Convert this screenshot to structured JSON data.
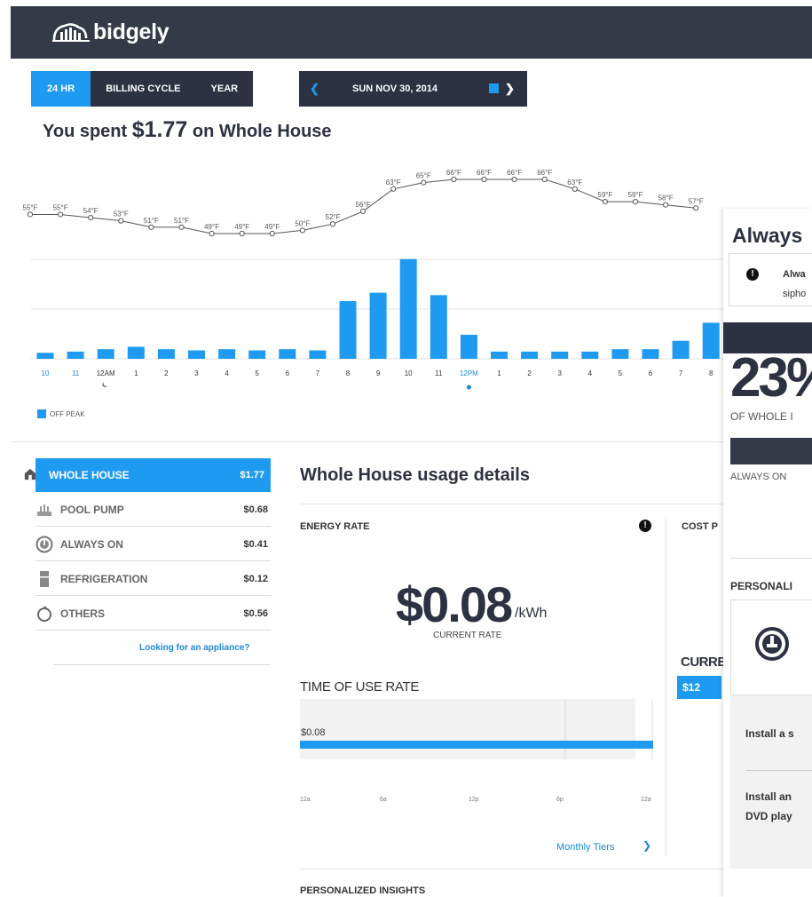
{
  "brand": {
    "name": "bidgely"
  },
  "range_buttons": [
    "24 HR",
    "BILLING CYCLE",
    "YEAR"
  ],
  "active_range": "24 HR",
  "date_nav": {
    "date": "SUN NOV 30, 2014",
    "prev_icon": "chevron-left-icon",
    "next_icon": "chevron-right-icon",
    "calendar_icon": "calendar-icon"
  },
  "headline": {
    "prefix": "You spent ",
    "amount": "$1.77",
    "suffix": " on Whole House"
  },
  "chart_data": {
    "type": "bar",
    "categories": [
      "10",
      "11",
      "12AM",
      "1",
      "2",
      "3",
      "4",
      "5",
      "6",
      "7",
      "8",
      "9",
      "10",
      "11",
      "12PM",
      "1",
      "2",
      "3",
      "4",
      "5",
      "6",
      "7",
      "8"
    ],
    "values": [
      0.5,
      0.6,
      0.8,
      1.0,
      0.8,
      0.7,
      0.8,
      0.7,
      0.8,
      0.7,
      4.8,
      5.5,
      8.3,
      5.3,
      2.0,
      0.6,
      0.6,
      0.6,
      0.6,
      0.8,
      0.8,
      1.5,
      3.0
    ],
    "temperatures": [
      "55°F",
      "55°F",
      "54°F",
      "53°F",
      "51°F",
      "51°F",
      "49°F",
      "49°F",
      "49°F",
      "50°F",
      "52°F",
      "56°F",
      "63°F",
      "65°F",
      "66°F",
      "66°F",
      "66°F",
      "66°F",
      "63°F",
      "59°F",
      "59°F",
      "58°F",
      "57°F"
    ],
    "temperature_values": [
      55,
      55,
      54,
      53,
      51,
      51,
      49,
      49,
      49,
      50,
      52,
      56,
      63,
      65,
      66,
      66,
      66,
      66,
      63,
      59,
      59,
      58,
      57
    ],
    "series_name": "OFF PEAK",
    "color": "#1e9bf0",
    "highlight_labels": [
      "10",
      "11",
      "12PM"
    ],
    "grid": true
  },
  "legend": {
    "label": "OFF PEAK"
  },
  "appliances": [
    {
      "name": "WHOLE HOUSE",
      "value": "$1.77",
      "icon": "house-icon",
      "active": true
    },
    {
      "name": "POOL PUMP",
      "value": "$0.68",
      "icon": "pool-pump-icon",
      "active": false
    },
    {
      "name": "ALWAYS ON",
      "value": "$0.41",
      "icon": "always-on-icon",
      "active": false
    },
    {
      "name": "REFRIGERATION",
      "value": "$0.12",
      "icon": "fridge-icon",
      "active": false
    },
    {
      "name": "OTHERS",
      "value": "$0.56",
      "icon": "others-icon",
      "active": false
    }
  ],
  "looking_link": "Looking for an appliance?",
  "details": {
    "title": "Whole House usage details",
    "energy_rate_label": "ENERGY RATE",
    "cost_label": "COST P",
    "rate_value": "$0.08",
    "rate_unit": "/kWh",
    "rate_sub": "CURRENT RATE",
    "tou_label": "TIME OF USE RATE",
    "tou_value": "$0.08",
    "tou_ticks": [
      "12a",
      "6a",
      "12p",
      "6p",
      "12a"
    ],
    "monthly_tiers": "Monthly Tiers",
    "insights_label": "PERSONALIZED INSIGHTS",
    "curre_label": "CURRE",
    "curre_value": "$12"
  },
  "side_panel": {
    "title": "Always",
    "alert_line1": "Alwa",
    "alert_line2": "sipho",
    "percent": "23%",
    "of_whole": "OF WHOLE I",
    "always_on_label": "ALWAYS ON",
    "personali": "PERSONALI",
    "install1": "Install a s",
    "install2": "Install an",
    "install3": "DVD play"
  }
}
